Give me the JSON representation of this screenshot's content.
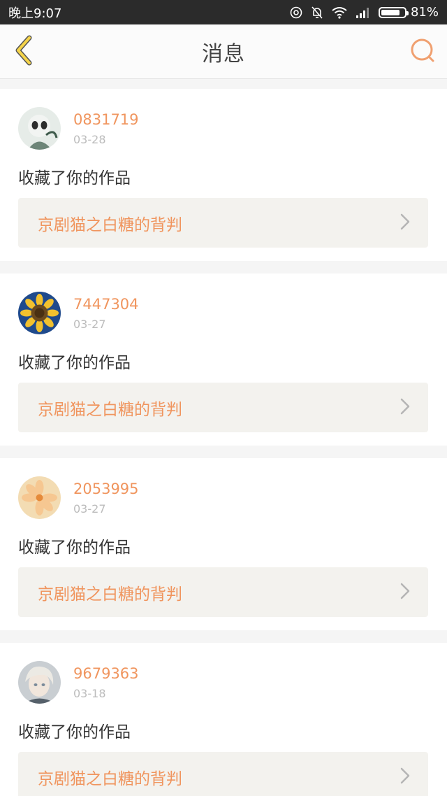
{
  "status_bar": {
    "time": "晚上9:07",
    "battery": "81%",
    "battery_level": 0.81
  },
  "header": {
    "title": "消息",
    "back_icon": "chevron-left-icon",
    "search_icon": "search-icon"
  },
  "colors": {
    "accent": "#f0955e",
    "back_icon": "#f0c33a"
  },
  "messages": [
    {
      "user": "0831719",
      "date": "03-28",
      "action": "收藏了你的作品",
      "work": "京剧猫之白糖的背判"
    },
    {
      "user": "7447304",
      "date": "03-27",
      "action": "收藏了你的作品",
      "work": "京剧猫之白糖的背判"
    },
    {
      "user": "2053995",
      "date": "03-27",
      "action": "收藏了你的作品",
      "work": "京剧猫之白糖的背判"
    },
    {
      "user": "9679363",
      "date": "03-18",
      "action": "收藏了你的作品",
      "work": "京剧猫之白糖的背判"
    }
  ]
}
